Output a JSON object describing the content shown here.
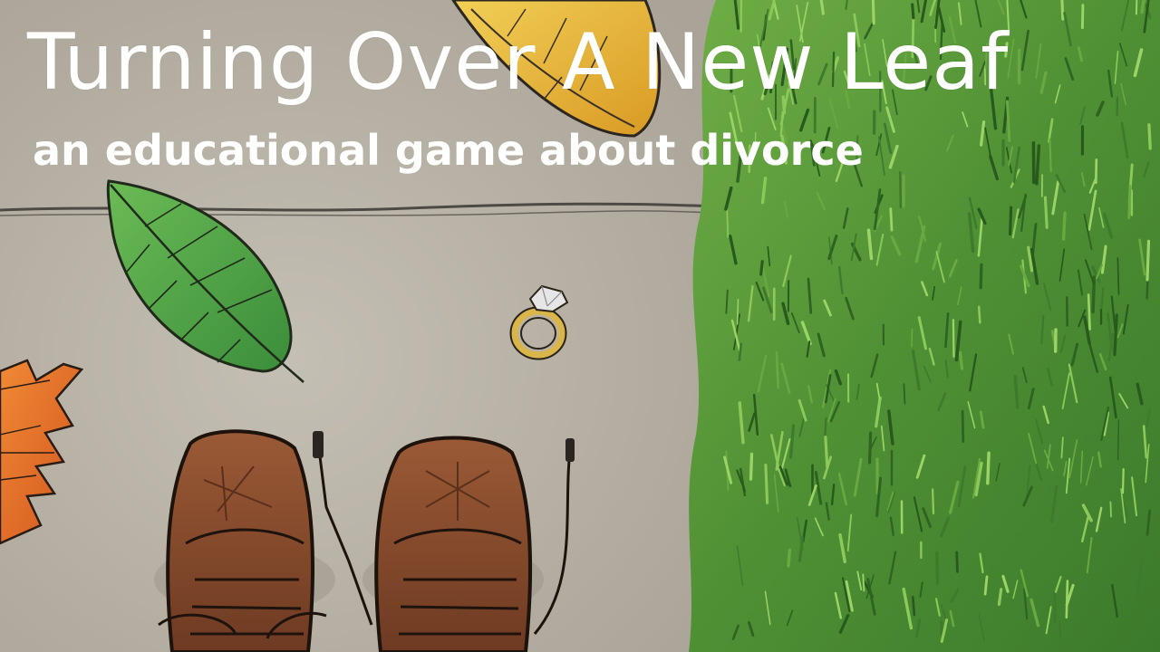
{
  "game": {
    "title": "Turning Over A New Leaf",
    "subtitle": "an educational game about divorce"
  },
  "colors": {
    "pavement": "#bab4a7",
    "grass_dark": "#3f7a2c",
    "grass_light": "#79b84a",
    "leaf_green": "#4ea84a",
    "leaf_yellow": "#e9b83a",
    "leaf_orange": "#e06a28",
    "shoe_brown": "#8a4a2c",
    "ring_gold": "#d9b54a",
    "text": "#ffffff"
  },
  "scene_items": [
    "yellow-leaf",
    "green-leaf",
    "orange-leaf",
    "wedding-ring",
    "left-shoe",
    "right-shoe",
    "grass-lawn",
    "pavement-crack"
  ]
}
